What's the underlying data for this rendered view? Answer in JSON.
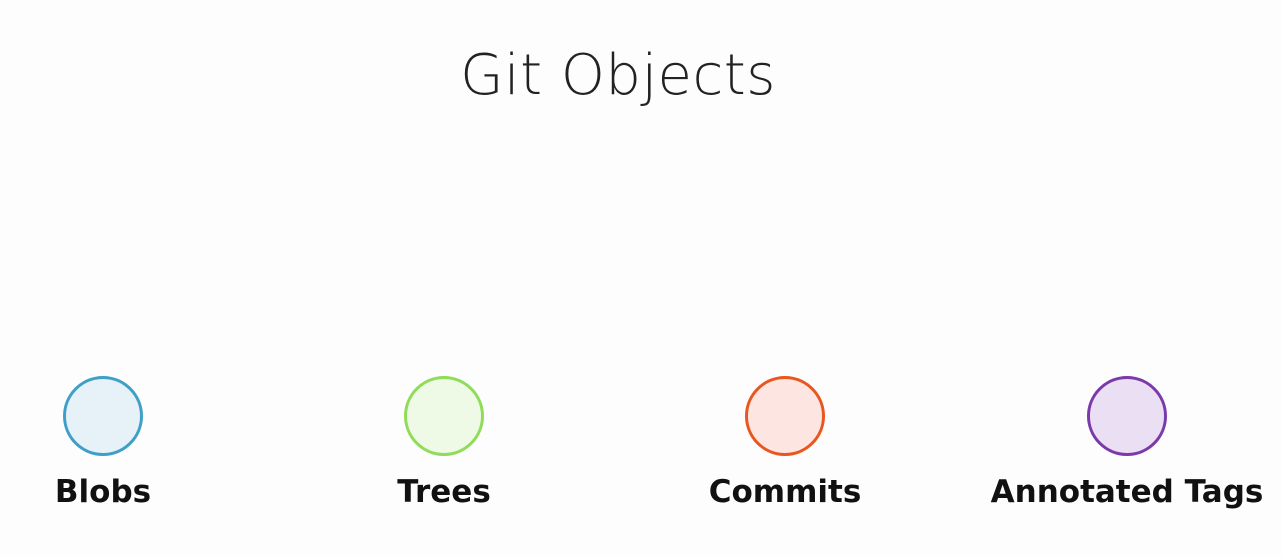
{
  "title": "Git Objects",
  "objects": [
    {
      "label": "Blobs",
      "stroke": "#3e9fc7",
      "fill": "#e6f1f8"
    },
    {
      "label": "Trees",
      "stroke": "#8fdc59",
      "fill": "#eef9e6"
    },
    {
      "label": "Commits",
      "stroke": "#e8571f",
      "fill": "#fde5e1"
    },
    {
      "label": "Annotated Tags",
      "stroke": "#7a3aab",
      "fill": "#ebdff4"
    }
  ]
}
